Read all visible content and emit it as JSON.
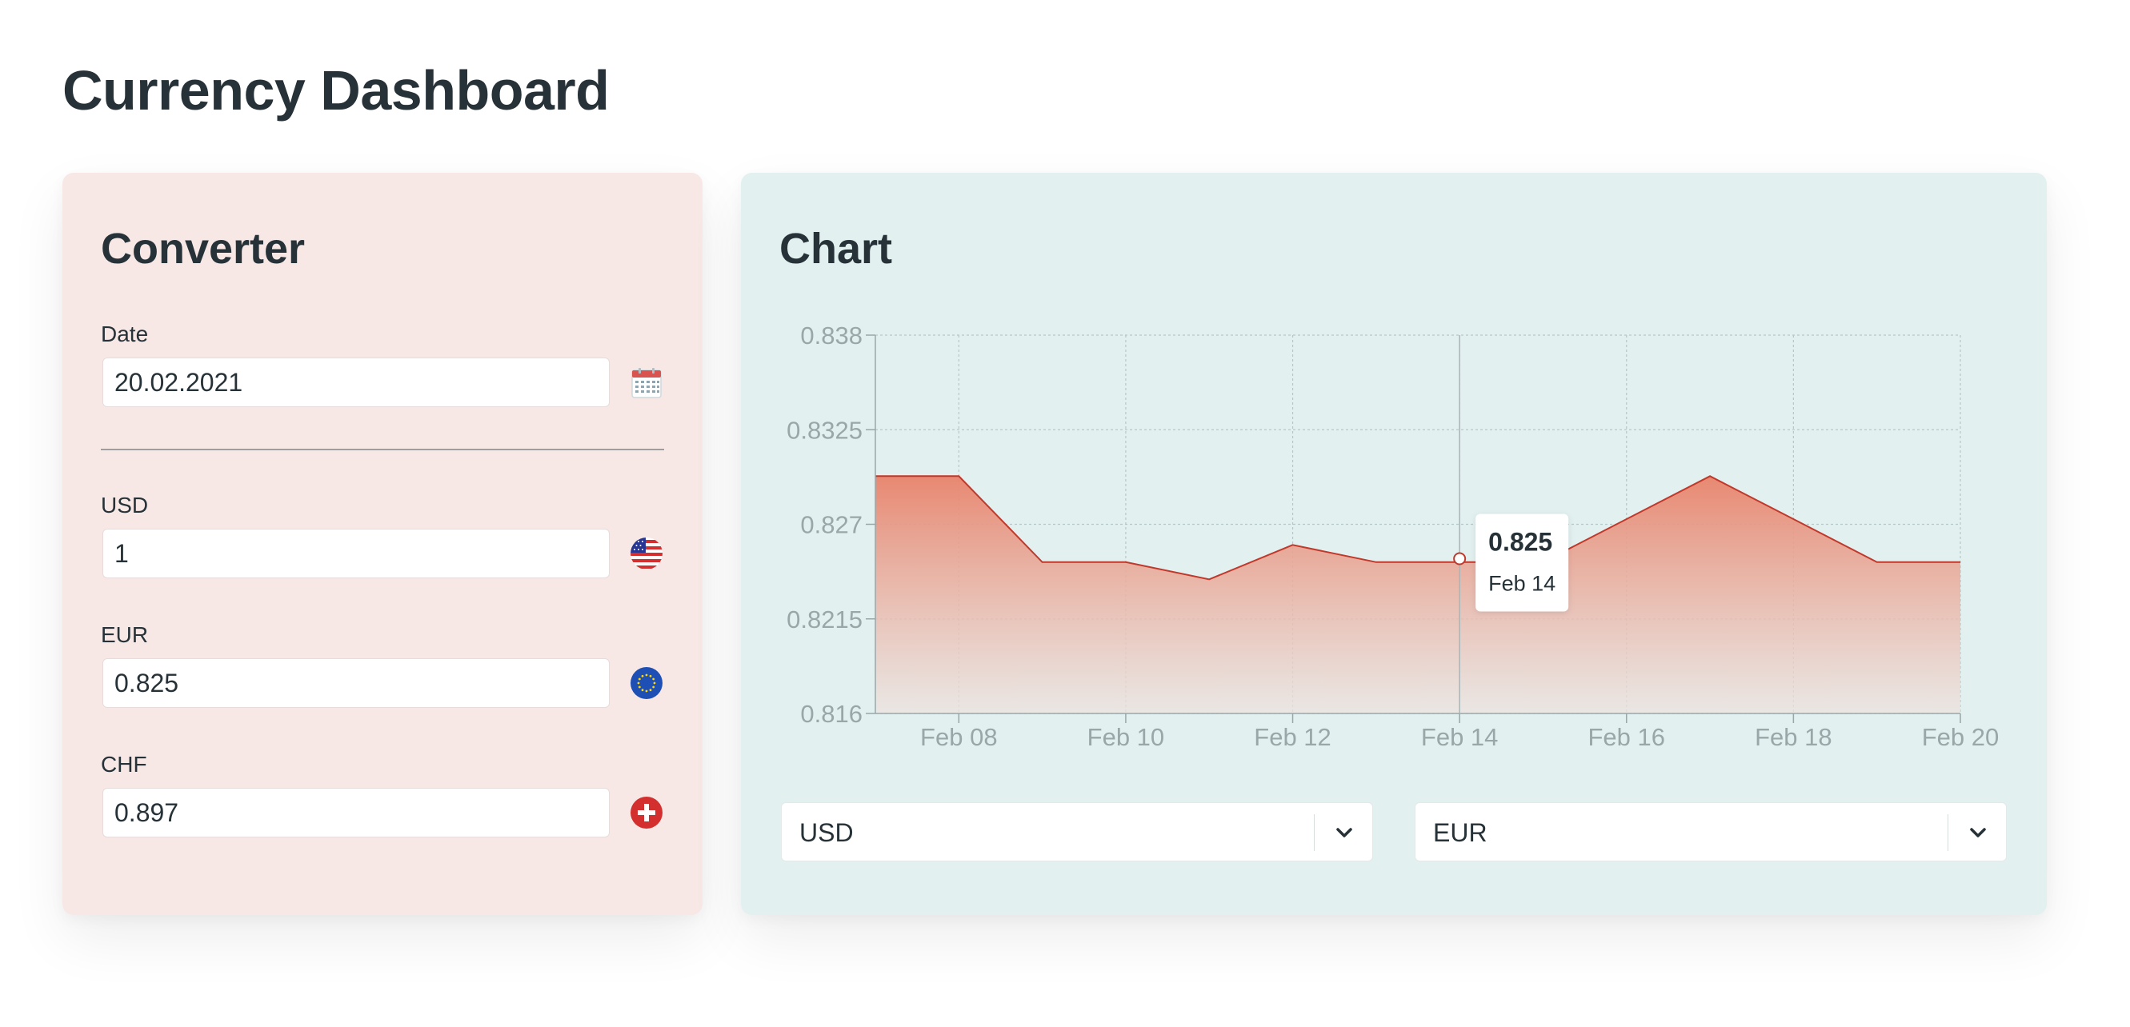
{
  "page": {
    "title": "Currency Dashboard"
  },
  "converter": {
    "title": "Converter",
    "date": {
      "label": "Date",
      "value": "20.02.2021",
      "icon": "calendar-icon"
    },
    "rates": [
      {
        "label": "USD",
        "value": "1",
        "icon": "us-flag-icon"
      },
      {
        "label": "EUR",
        "value": "0.825",
        "icon": "eu-flag-icon"
      },
      {
        "label": "CHF",
        "value": "0.897",
        "icon": "swiss-flag-icon"
      }
    ]
  },
  "chart": {
    "title": "Chart",
    "selects": {
      "from": "USD",
      "to": "EUR"
    },
    "tooltip": {
      "value": "0.825",
      "date": "Feb 14"
    }
  },
  "colors": {
    "accent": "#c0392b",
    "area_top": "#e8836b",
    "converter_bg": "#f7e8e6",
    "chart_bg": "#e2f0f0"
  },
  "chart_data": {
    "type": "area",
    "title": "",
    "xlabel": "",
    "ylabel": "",
    "x": [
      "2021-02-07",
      "2021-02-08",
      "2021-02-09",
      "2021-02-10",
      "2021-02-11",
      "2021-02-12",
      "2021-02-13",
      "2021-02-14",
      "2021-02-15",
      "2021-02-16",
      "2021-02-17",
      "2021-02-18",
      "2021-02-19",
      "2021-02-20"
    ],
    "series": [
      {
        "values": [
          0.8298,
          0.8298,
          0.8248,
          0.8248,
          0.8238,
          0.8258,
          0.8248,
          0.8248,
          0.8248,
          0.8273,
          0.8298,
          0.8273,
          0.8248,
          0.8248
        ]
      }
    ],
    "xticks": [
      "Feb 08",
      "Feb 10",
      "Feb 12",
      "Feb 14",
      "Feb 16",
      "Feb 18",
      "Feb 20"
    ],
    "yticks": [
      "0.816",
      "0.8215",
      "0.827",
      "0.8325",
      "0.838"
    ],
    "ylim": [
      0.816,
      0.838
    ],
    "xlim": [
      "2021-02-07",
      "2021-02-20"
    ],
    "grid": true,
    "highlight": {
      "x": "2021-02-14",
      "y": 0.825
    }
  }
}
